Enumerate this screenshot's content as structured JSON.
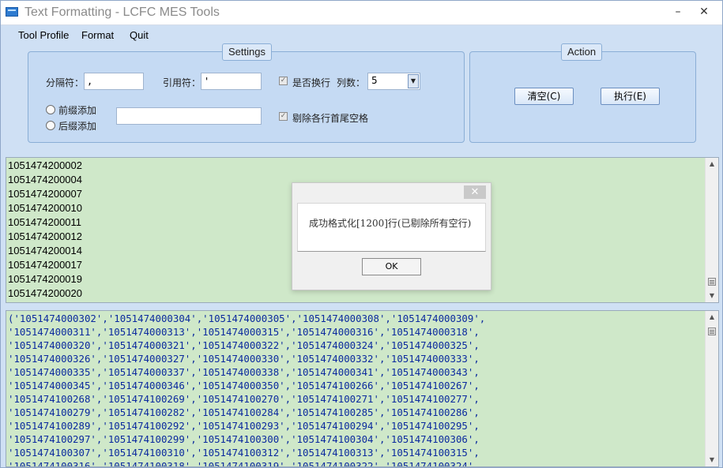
{
  "window": {
    "title": "Text Formatting - LCFC MES Tools",
    "minimize": "–",
    "close": "✕"
  },
  "menu": [
    {
      "label": "Tool Profile"
    },
    {
      "label": "Format"
    },
    {
      "label": "Quit"
    }
  ],
  "settings": {
    "title": "Settings",
    "separator_label": "分隔符：",
    "separator_value": ",",
    "quote_label": "引用符：",
    "quote_value": "'",
    "wrap_checkbox_label": "是否换行",
    "wrap_checked": true,
    "columns_label": "列数：",
    "columns_value": "5",
    "prefix_label": "前缀添加",
    "suffix_label": "后缀添加",
    "affix_value": "",
    "trim_checkbox_label": "剔除各行首尾空格",
    "trim_checked": true
  },
  "action": {
    "title": "Action",
    "clear_label": "清空(C)",
    "execute_label": "执行(E)"
  },
  "input_lines": [
    "1051474200002",
    "1051474200004",
    "1051474200007",
    "1051474200010",
    "1051474200011",
    "1051474200012",
    "1051474200014",
    "1051474200017",
    "1051474200019",
    "1051474200020"
  ],
  "output_lines": [
    "('1051474000302','1051474000304','1051474000305','1051474000308','1051474000309',",
    "'1051474000311','1051474000313','1051474000315','1051474000316','1051474000318',",
    "'1051474000320','1051474000321','1051474000322','1051474000324','1051474000325',",
    "'1051474000326','1051474000327','1051474000330','1051474000332','1051474000333',",
    "'1051474000335','1051474000337','1051474000338','1051474000341','1051474000343',",
    "'1051474000345','1051474000346','1051474000350','1051474100266','1051474100267',",
    "'1051474100268','1051474100269','1051474100270','1051474100271','1051474100277',",
    "'1051474100279','1051474100282','1051474100284','1051474100285','1051474100286',",
    "'1051474100289','1051474100292','1051474100293','1051474100294','1051474100295',",
    "'1051474100297','1051474100299','1051474100300','1051474100304','1051474100306',",
    "'1051474100307','1051474100310','1051474100312','1051474100313','1051474100315',",
    "'1051474100316','1051474100318','1051474100319','1051474100322','1051474100324',"
  ],
  "dialog": {
    "close": "✕",
    "message": "成功格式化[1200]行(已剔除所有空行)",
    "ok_label": "OK"
  },
  "colors": {
    "text_area_bg": "#cfe8c9",
    "output_text": "#0b2a9e",
    "panel_bg": "#c5daf3"
  }
}
